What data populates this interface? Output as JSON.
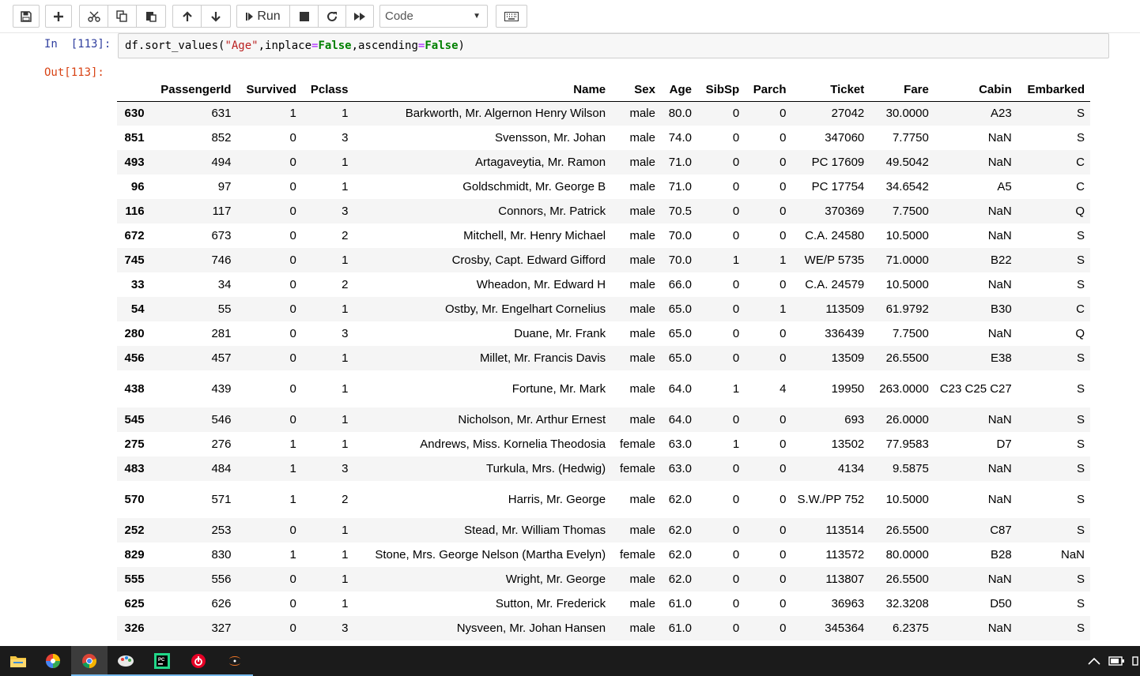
{
  "toolbar": {
    "run_label": "Run",
    "cell_type": "Code"
  },
  "cell": {
    "in_prompt": "In  [113]:",
    "out_prompt": "Out[113]:",
    "code": {
      "part1": "df.sort_values(",
      "str": "\"Age\"",
      "part2": ",inplace",
      "eq1": "=",
      "kw1": "False",
      "part3": ",ascending",
      "eq2": "=",
      "kw2": "False",
      "part4": ")"
    }
  },
  "table": {
    "columns": [
      "PassengerId",
      "Survived",
      "Pclass",
      "Name",
      "Sex",
      "Age",
      "SibSp",
      "Parch",
      "Ticket",
      "Fare",
      "Cabin",
      "Embarked"
    ],
    "rows": [
      {
        "idx": "630",
        "cells": [
          "631",
          "1",
          "1",
          "Barkworth, Mr. Algernon Henry Wilson",
          "male",
          "80.0",
          "0",
          "0",
          "27042",
          "30.0000",
          "A23",
          "S"
        ]
      },
      {
        "idx": "851",
        "cells": [
          "852",
          "0",
          "3",
          "Svensson, Mr. Johan",
          "male",
          "74.0",
          "0",
          "0",
          "347060",
          "7.7750",
          "NaN",
          "S"
        ]
      },
      {
        "idx": "493",
        "cells": [
          "494",
          "0",
          "1",
          "Artagaveytia, Mr. Ramon",
          "male",
          "71.0",
          "0",
          "0",
          "PC 17609",
          "49.5042",
          "NaN",
          "C"
        ]
      },
      {
        "idx": "96",
        "cells": [
          "97",
          "0",
          "1",
          "Goldschmidt, Mr. George B",
          "male",
          "71.0",
          "0",
          "0",
          "PC 17754",
          "34.6542",
          "A5",
          "C"
        ]
      },
      {
        "idx": "116",
        "cells": [
          "117",
          "0",
          "3",
          "Connors, Mr. Patrick",
          "male",
          "70.5",
          "0",
          "0",
          "370369",
          "7.7500",
          "NaN",
          "Q"
        ]
      },
      {
        "idx": "672",
        "cells": [
          "673",
          "0",
          "2",
          "Mitchell, Mr. Henry Michael",
          "male",
          "70.0",
          "0",
          "0",
          "C.A. 24580",
          "10.5000",
          "NaN",
          "S"
        ]
      },
      {
        "idx": "745",
        "cells": [
          "746",
          "0",
          "1",
          "Crosby, Capt. Edward Gifford",
          "male",
          "70.0",
          "1",
          "1",
          "WE/P 5735",
          "71.0000",
          "B22",
          "S"
        ]
      },
      {
        "idx": "33",
        "cells": [
          "34",
          "0",
          "2",
          "Wheadon, Mr. Edward H",
          "male",
          "66.0",
          "0",
          "0",
          "C.A. 24579",
          "10.5000",
          "NaN",
          "S"
        ]
      },
      {
        "idx": "54",
        "cells": [
          "55",
          "0",
          "1",
          "Ostby, Mr. Engelhart Cornelius",
          "male",
          "65.0",
          "0",
          "1",
          "113509",
          "61.9792",
          "B30",
          "C"
        ]
      },
      {
        "idx": "280",
        "cells": [
          "281",
          "0",
          "3",
          "Duane, Mr. Frank",
          "male",
          "65.0",
          "0",
          "0",
          "336439",
          "7.7500",
          "NaN",
          "Q"
        ]
      },
      {
        "idx": "456",
        "cells": [
          "457",
          "0",
          "1",
          "Millet, Mr. Francis Davis",
          "male",
          "65.0",
          "0",
          "0",
          "13509",
          "26.5500",
          "E38",
          "S"
        ]
      },
      {
        "idx": "438",
        "cells": [
          "439",
          "0",
          "1",
          "Fortune, Mr. Mark",
          "male",
          "64.0",
          "1",
          "4",
          "19950",
          "263.0000",
          "C23 C25 C27",
          "S"
        ]
      },
      {
        "idx": "545",
        "cells": [
          "546",
          "0",
          "1",
          "Nicholson, Mr. Arthur Ernest",
          "male",
          "64.0",
          "0",
          "0",
          "693",
          "26.0000",
          "NaN",
          "S"
        ]
      },
      {
        "idx": "275",
        "cells": [
          "276",
          "1",
          "1",
          "Andrews, Miss. Kornelia Theodosia",
          "female",
          "63.0",
          "1",
          "0",
          "13502",
          "77.9583",
          "D7",
          "S"
        ]
      },
      {
        "idx": "483",
        "cells": [
          "484",
          "1",
          "3",
          "Turkula, Mrs. (Hedwig)",
          "female",
          "63.0",
          "0",
          "0",
          "4134",
          "9.5875",
          "NaN",
          "S"
        ]
      },
      {
        "idx": "570",
        "cells": [
          "571",
          "1",
          "2",
          "Harris, Mr. George",
          "male",
          "62.0",
          "0",
          "0",
          "S.W./PP 752",
          "10.5000",
          "NaN",
          "S"
        ]
      },
      {
        "idx": "252",
        "cells": [
          "253",
          "0",
          "1",
          "Stead, Mr. William Thomas",
          "male",
          "62.0",
          "0",
          "0",
          "113514",
          "26.5500",
          "C87",
          "S"
        ]
      },
      {
        "idx": "829",
        "cells": [
          "830",
          "1",
          "1",
          "Stone, Mrs. George Nelson (Martha Evelyn)",
          "female",
          "62.0",
          "0",
          "0",
          "113572",
          "80.0000",
          "B28",
          "NaN"
        ]
      },
      {
        "idx": "555",
        "cells": [
          "556",
          "0",
          "1",
          "Wright, Mr. George",
          "male",
          "62.0",
          "0",
          "0",
          "113807",
          "26.5500",
          "NaN",
          "S"
        ]
      },
      {
        "idx": "625",
        "cells": [
          "626",
          "0",
          "1",
          "Sutton, Mr. Frederick",
          "male",
          "61.0",
          "0",
          "0",
          "36963",
          "32.3208",
          "D50",
          "S"
        ]
      },
      {
        "idx": "326",
        "cells": [
          "327",
          "0",
          "3",
          "Nysveen, Mr. Johan Hansen",
          "male",
          "61.0",
          "0",
          "0",
          "345364",
          "6.2375",
          "NaN",
          "S"
        ]
      }
    ]
  },
  "taskbar": {
    "apps": [
      "file-explorer-icon",
      "color-app-icon",
      "chrome-icon",
      "paint-app-icon",
      "pycharm-icon",
      "netease-music-icon",
      "jupyter-icon"
    ]
  }
}
